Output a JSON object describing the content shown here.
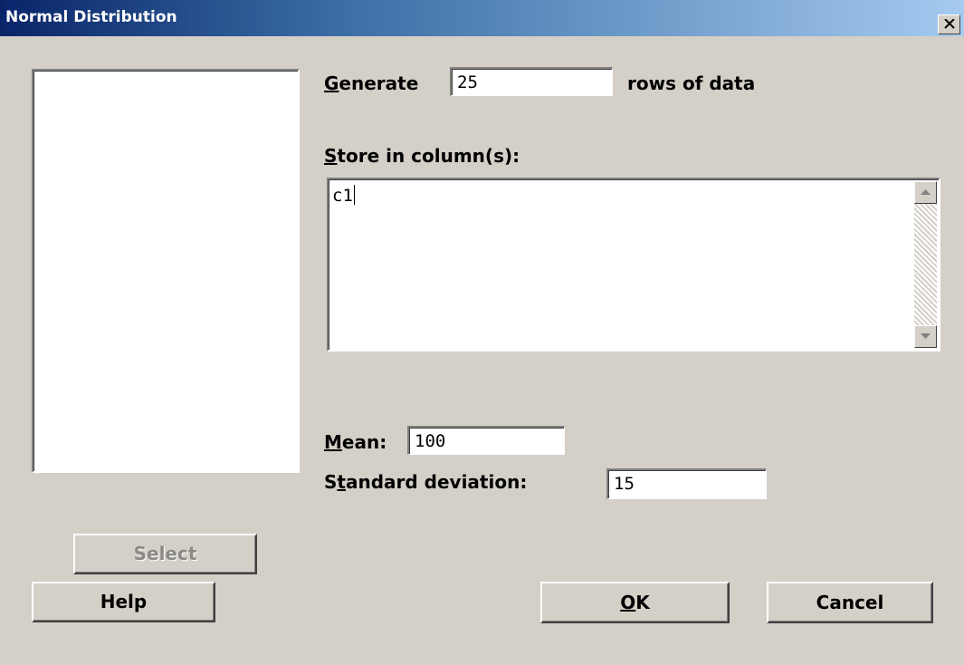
{
  "window": {
    "title": "Normal Distribution",
    "close_icon": "close-icon"
  },
  "form": {
    "generate_label": "Generate",
    "generate_mnemonic": "G",
    "generate_rest": "enerate",
    "rows_value": "25",
    "rows_suffix": "rows of data",
    "store_label_mnemonic": "S",
    "store_label_rest": "tore in column(s):",
    "store_value": "c1",
    "mean_mnemonic": "M",
    "mean_rest": "ean:",
    "mean_value": "100",
    "std_prefix": "S",
    "std_mnemonic": "t",
    "std_rest": "andard deviation:",
    "std_value": "15"
  },
  "buttons": {
    "select": "Select",
    "help": "Help",
    "ok_mnemonic": "O",
    "ok_rest": "K",
    "cancel": "Cancel"
  },
  "colors": {
    "title_gradient_start": "#0a246a",
    "title_gradient_end": "#a6caf0",
    "face": "#d4d0c8"
  }
}
